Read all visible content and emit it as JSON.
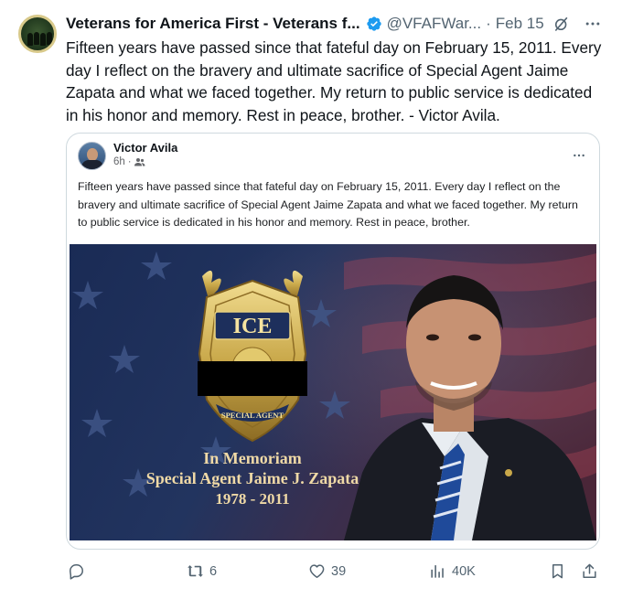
{
  "tweet": {
    "author_name": "Veterans for America First - Veterans f...",
    "handle": "@VFAFWar...",
    "separator": "·",
    "date": "Feb 15",
    "text": "Fifteen years have passed since that fateful day on February 15, 2011. Every day I reflect on the bravery and ultimate sacrifice of Special Agent Jaime Zapata and what we faced together. My return to public service is dedicated in his honor and memory. Rest in peace, brother. - Victor Avila."
  },
  "quoted_post": {
    "author_name": "Victor Avila",
    "time": "6h",
    "separator": "·",
    "text": "Fifteen years have passed since that fateful day on February 15, 2011. Every day I reflect on the bravery and ultimate sacrifice of Special Agent Jaime Zapata and  what we faced together. My return to public service is dedicated in his honor and memory. Rest in peace, brother.",
    "image": {
      "badge_top": "ICE",
      "badge_bottom": "SPECIAL AGENT",
      "caption_line1": "In Memoriam",
      "caption_line2": "Special Agent Jaime J. Zapata",
      "caption_line3": "1978 - 2011"
    }
  },
  "actions": {
    "replies_icon": "reply-icon",
    "reposts": "6",
    "likes": "39",
    "views": "40K",
    "bookmark_icon": "bookmark-icon",
    "share_icon": "share-icon"
  },
  "colors": {
    "verified": "#1d9bf0",
    "secondary_text": "#536471",
    "border": "#cfd9de",
    "flag_blue": "#1d2f5c",
    "flag_red": "#7a2a36",
    "gold": "#c9a84a"
  }
}
